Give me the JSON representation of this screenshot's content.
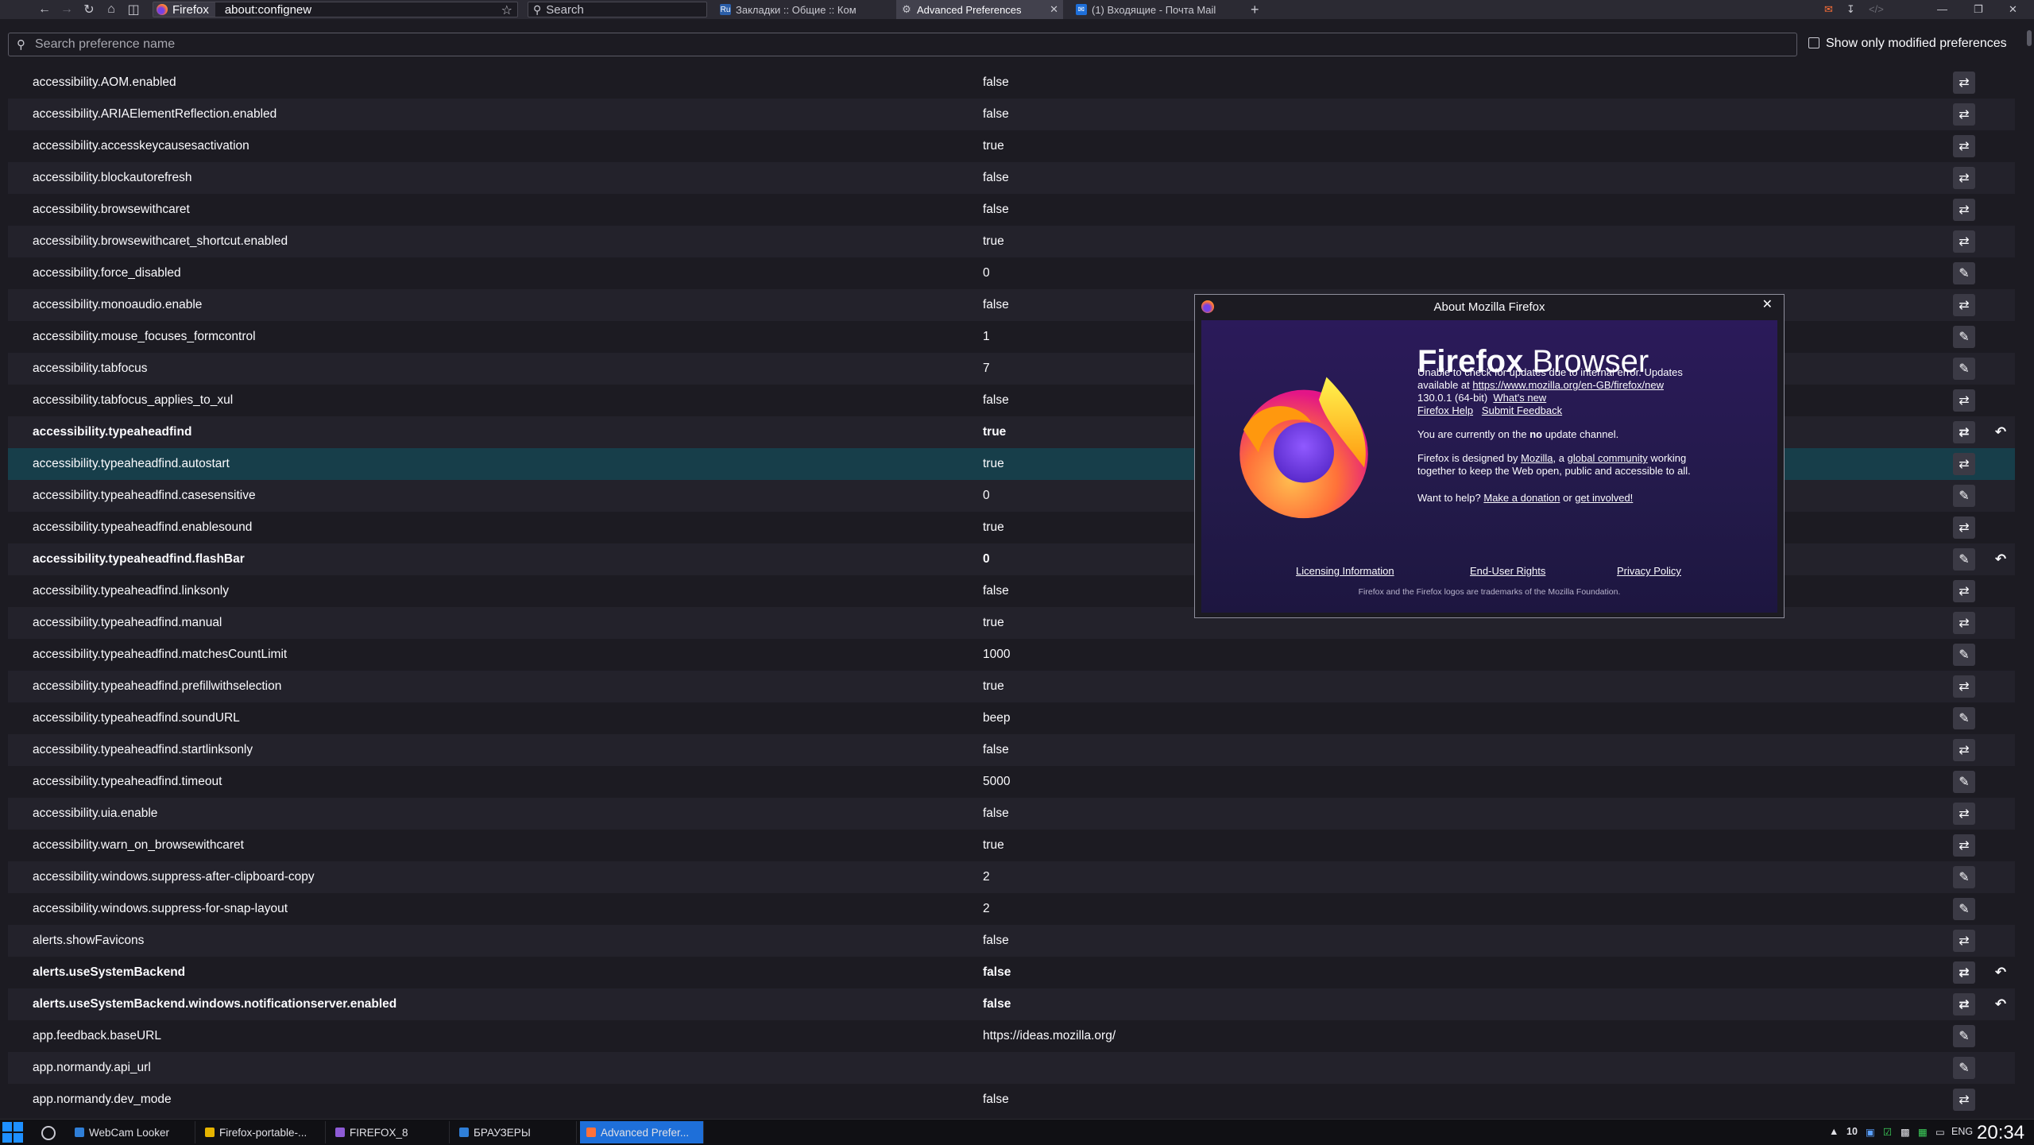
{
  "browser": {
    "identity_label": "Firefox",
    "url": "about:confignew",
    "search_placeholder": "Search",
    "tabs": [
      {
        "label": "Закладки :: Общие :: Ком",
        "icon": "Ru"
      },
      {
        "label": "Advanced Preferences",
        "icon": "gear"
      },
      {
        "label": "(1) Входящие - Почта Mail",
        "icon": "mail"
      }
    ]
  },
  "config": {
    "search_placeholder": "Search preference name",
    "modified_only_label": "Show only modified preferences",
    "prefs": [
      {
        "name": "accessibility.AOM.enabled",
        "value": "false",
        "type": "bool",
        "modified": false
      },
      {
        "name": "accessibility.ARIAElementReflection.enabled",
        "value": "false",
        "type": "bool",
        "modified": false
      },
      {
        "name": "accessibility.accesskeycausesactivation",
        "value": "true",
        "type": "bool",
        "modified": false
      },
      {
        "name": "accessibility.blockautorefresh",
        "value": "false",
        "type": "bool",
        "modified": false
      },
      {
        "name": "accessibility.browsewithcaret",
        "value": "false",
        "type": "bool",
        "modified": false
      },
      {
        "name": "accessibility.browsewithcaret_shortcut.enabled",
        "value": "true",
        "type": "bool",
        "modified": false
      },
      {
        "name": "accessibility.force_disabled",
        "value": "0",
        "type": "edit",
        "modified": false
      },
      {
        "name": "accessibility.monoaudio.enable",
        "value": "false",
        "type": "bool",
        "modified": false
      },
      {
        "name": "accessibility.mouse_focuses_formcontrol",
        "value": "1",
        "type": "edit",
        "modified": false
      },
      {
        "name": "accessibility.tabfocus",
        "value": "7",
        "type": "edit",
        "modified": false
      },
      {
        "name": "accessibility.tabfocus_applies_to_xul",
        "value": "false",
        "type": "bool",
        "modified": false
      },
      {
        "name": "accessibility.typeaheadfind",
        "value": "true",
        "type": "bool",
        "modified": true
      },
      {
        "name": "accessibility.typeaheadfind.autostart",
        "value": "true",
        "type": "bool",
        "modified": false,
        "selected": true
      },
      {
        "name": "accessibility.typeaheadfind.casesensitive",
        "value": "0",
        "type": "edit",
        "modified": false
      },
      {
        "name": "accessibility.typeaheadfind.enablesound",
        "value": "true",
        "type": "bool",
        "modified": false
      },
      {
        "name": "accessibility.typeaheadfind.flashBar",
        "value": "0",
        "type": "edit",
        "modified": true
      },
      {
        "name": "accessibility.typeaheadfind.linksonly",
        "value": "false",
        "type": "bool",
        "modified": false
      },
      {
        "name": "accessibility.typeaheadfind.manual",
        "value": "true",
        "type": "bool",
        "modified": false
      },
      {
        "name": "accessibility.typeaheadfind.matchesCountLimit",
        "value": "1000",
        "type": "edit",
        "modified": false
      },
      {
        "name": "accessibility.typeaheadfind.prefillwithselection",
        "value": "true",
        "type": "bool",
        "modified": false
      },
      {
        "name": "accessibility.typeaheadfind.soundURL",
        "value": "beep",
        "type": "edit",
        "modified": false
      },
      {
        "name": "accessibility.typeaheadfind.startlinksonly",
        "value": "false",
        "type": "bool",
        "modified": false
      },
      {
        "name": "accessibility.typeaheadfind.timeout",
        "value": "5000",
        "type": "edit",
        "modified": false
      },
      {
        "name": "accessibility.uia.enable",
        "value": "false",
        "type": "bool",
        "modified": false
      },
      {
        "name": "accessibility.warn_on_browsewithcaret",
        "value": "true",
        "type": "bool",
        "modified": false
      },
      {
        "name": "accessibility.windows.suppress-after-clipboard-copy",
        "value": "2",
        "type": "edit",
        "modified": false
      },
      {
        "name": "accessibility.windows.suppress-for-snap-layout",
        "value": "2",
        "type": "edit",
        "modified": false
      },
      {
        "name": "alerts.showFavicons",
        "value": "false",
        "type": "bool",
        "modified": false
      },
      {
        "name": "alerts.useSystemBackend",
        "value": "false",
        "type": "bool",
        "modified": true
      },
      {
        "name": "alerts.useSystemBackend.windows.notificationserver.enabled",
        "value": "false",
        "type": "bool",
        "modified": true
      },
      {
        "name": "app.feedback.baseURL",
        "value": "https://ideas.mozilla.org/",
        "type": "edit",
        "modified": false
      },
      {
        "name": "app.normandy.api_url",
        "value": "",
        "type": "edit",
        "modified": false
      },
      {
        "name": "app.normandy.dev_mode",
        "value": "false",
        "type": "bool",
        "modified": false
      }
    ]
  },
  "about": {
    "title": "About Mozilla Firefox",
    "brand_bold": "Firefox",
    "brand_light": "Browser",
    "update_line1": "Unable to check for updates due to internal error. Updates",
    "update_line2_prefix": "available at",
    "update_url": "https://www.mozilla.org/en-GB/firefox/new",
    "version": "130.0.1 (64-bit)",
    "whats_new": "What's new",
    "help": "Firefox Help",
    "feedback": "Submit Feedback",
    "channel_prefix": "You are currently on the",
    "channel_name": "no",
    "channel_suffix": "update channel.",
    "designed_prefix": "Firefox is designed by",
    "designed_mozilla": "Mozilla",
    "designed_mid": ", a",
    "designed_community": "global community",
    "designed_suffix": "working",
    "designed_line2": "together to keep the Web open, public and accessible to all.",
    "help_prefix": "Want to help?",
    "donation": "Make a donation",
    "help_or": "or",
    "involved": "get involved!",
    "licensing": "Licensing Information",
    "eula": "End-User Rights",
    "privacy": "Privacy Policy",
    "trademark": "Firefox and the Firefox logos are trademarks of the Mozilla Foundation."
  },
  "taskbar": {
    "tasks": [
      {
        "label": "WebCam Looker",
        "color": "#2f7fd8"
      },
      {
        "label": "Firefox-portable-...",
        "color": "#e6b400"
      },
      {
        "label": "FIREFOX_8",
        "color": "#8e5bd6"
      },
      {
        "label": "БРАУЗЕРЫ",
        "color": "#2f7fd8"
      },
      {
        "label": "Advanced Prefer...",
        "color": "#ff7139"
      }
    ],
    "tray_count": "10",
    "lang": "ENG",
    "clock": "20:34"
  },
  "colors": {
    "accent": "#1e6fd9",
    "selected_row": "#173e4a",
    "dialog_purple": "#2b1a5a"
  }
}
